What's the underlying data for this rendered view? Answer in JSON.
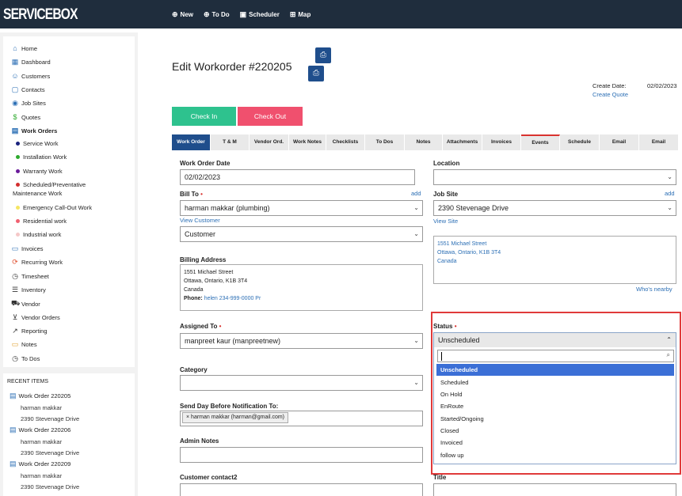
{
  "app": {
    "logo": "SERVICEBOX"
  },
  "topnav": [
    {
      "icon": "plus-circle-icon",
      "glyph": "⊕",
      "label": "New"
    },
    {
      "icon": "plus-circle-icon",
      "glyph": "⊕",
      "label": "To Do"
    },
    {
      "icon": "calendar-icon",
      "glyph": "▣",
      "label": "Scheduler"
    },
    {
      "icon": "map-icon",
      "glyph": "⊞",
      "label": "Map"
    }
  ],
  "sidebar": {
    "items": [
      {
        "label": "Home",
        "glyph": "⌂"
      },
      {
        "label": "Dashboard",
        "glyph": "▦"
      },
      {
        "label": "Customers",
        "glyph": "☺"
      },
      {
        "label": "Contacts",
        "glyph": "▢"
      },
      {
        "label": "Job Sites",
        "glyph": "◉"
      },
      {
        "label": "Quotes",
        "glyph": "$"
      },
      {
        "label": "Work Orders",
        "glyph": "▤"
      }
    ],
    "work_types": [
      {
        "label": "Service Work",
        "color": "#1a237e"
      },
      {
        "label": "Installation Work",
        "color": "#2eaa2e"
      },
      {
        "label": "Warranty Work",
        "color": "#6a1b9a"
      },
      {
        "label": "Scheduled/Preventative",
        "color": "#d32f2f"
      },
      {
        "label": "Maintenance Work",
        "color": ""
      },
      {
        "label": "Emergency Call-Out Work",
        "color": "#f5e663"
      },
      {
        "label": "Residential work",
        "color": "#f06070"
      },
      {
        "label": "Industrial work",
        "color": "#f5c8c8"
      }
    ],
    "items2": [
      {
        "label": "Invoices",
        "glyph": "▭"
      },
      {
        "label": "Recurring Work",
        "glyph": "⟳"
      },
      {
        "label": "Timesheet",
        "glyph": "◷"
      },
      {
        "label": "Inventory",
        "glyph": "☰"
      },
      {
        "label": "Vendor",
        "glyph": "⛟"
      },
      {
        "label": "Vendor Orders",
        "glyph": "⊻"
      },
      {
        "label": "Reporting",
        "glyph": "↗"
      },
      {
        "label": "Notes",
        "glyph": "▭"
      },
      {
        "label": "To Dos",
        "glyph": "◷"
      }
    ]
  },
  "recent": {
    "title": "RECENT ITEMS",
    "items": [
      {
        "title": "Work Order 220205",
        "line1": "harman makkar",
        "line2": "2390 Stevenage Drive"
      },
      {
        "title": "Work Order 220206",
        "line1": "harman makkar",
        "line2": "2390 Stevenage Drive"
      },
      {
        "title": "Work Order 220209",
        "line1": "harman makkar",
        "line2": "2390 Stevenage Drive"
      }
    ]
  },
  "page": {
    "title": "Edit Workorder #220205",
    "create_date_label": "Create Date:",
    "create_date_value": "02/02/2023",
    "create_quote": "Create Quote",
    "check_in": "Check In",
    "check_out": "Check Out"
  },
  "tabs": [
    "Work Order",
    "T & M",
    "Vendor Ord.",
    "Work Notes",
    "Checklists",
    "To Dos",
    "Notes",
    "Attachments",
    "Invoices",
    "Events",
    "Schedule",
    "Email",
    "Email"
  ],
  "form": {
    "wo_date_label": "Work Order Date",
    "wo_date_value": "02/02/2023",
    "location_label": "Location",
    "bill_to_label": "Bill To",
    "bill_to_value": "harman makkar (plumbing)",
    "add": "add",
    "view_customer": "View Customer",
    "customer_type": "Customer",
    "job_site_label": "Job Site",
    "job_site_value": "2390 Stevenage Drive",
    "view_site": "View Site",
    "site_addr1": "1551 Michael Street",
    "site_addr2": "Ottawa, Ontario, K1B 3T4",
    "site_addr3": "Canada",
    "whos_nearby": "Who's nearby",
    "billing_label": "Billing Address",
    "bill_addr1": "1551 Michael Street",
    "bill_addr2": "Ottawa, Ontario, K1B 3T4",
    "bill_addr3": "Canada",
    "phone_label": "Phone:",
    "phone_value": "helen 234-999-0000 Pr",
    "assigned_label": "Assigned To",
    "assigned_value": "manpreet kaur (manpreetnew)",
    "status_label": "Status",
    "status_value": "Unscheduled",
    "category_label": "Category",
    "notify_label": "Send Day Before Notification To:",
    "notify_chip": "harman makkar (harman@gmail.com)",
    "admin_notes_label": "Admin Notes",
    "contact2_label": "Customer contact2",
    "title_label": "Title"
  },
  "status_options": [
    "Unscheduled",
    "Scheduled",
    "On Hold",
    "EnRoute",
    "Started/Ongoing",
    "Closed",
    "Invoiced",
    "follow up"
  ]
}
